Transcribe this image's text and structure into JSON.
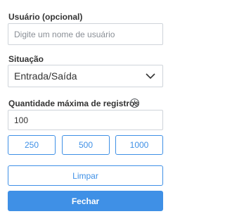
{
  "user_field": {
    "label": "Usuário (opcional)",
    "placeholder": "Digite um nome de usuário",
    "value": ""
  },
  "situation": {
    "label": "Situação",
    "selected": "Entrada/Saída",
    "chevron_icon": "chevron-down-icon"
  },
  "max_records": {
    "label": "Quantidade máxima de registros",
    "info_icon_glyph": "!",
    "value": "100",
    "presets": [
      "250",
      "500",
      "1000"
    ]
  },
  "actions": {
    "clear_label": "Limpar",
    "close_label": "Fechar"
  },
  "colors": {
    "accent": "#3f90e6",
    "text": "#333333",
    "border": "#cfd4da"
  }
}
